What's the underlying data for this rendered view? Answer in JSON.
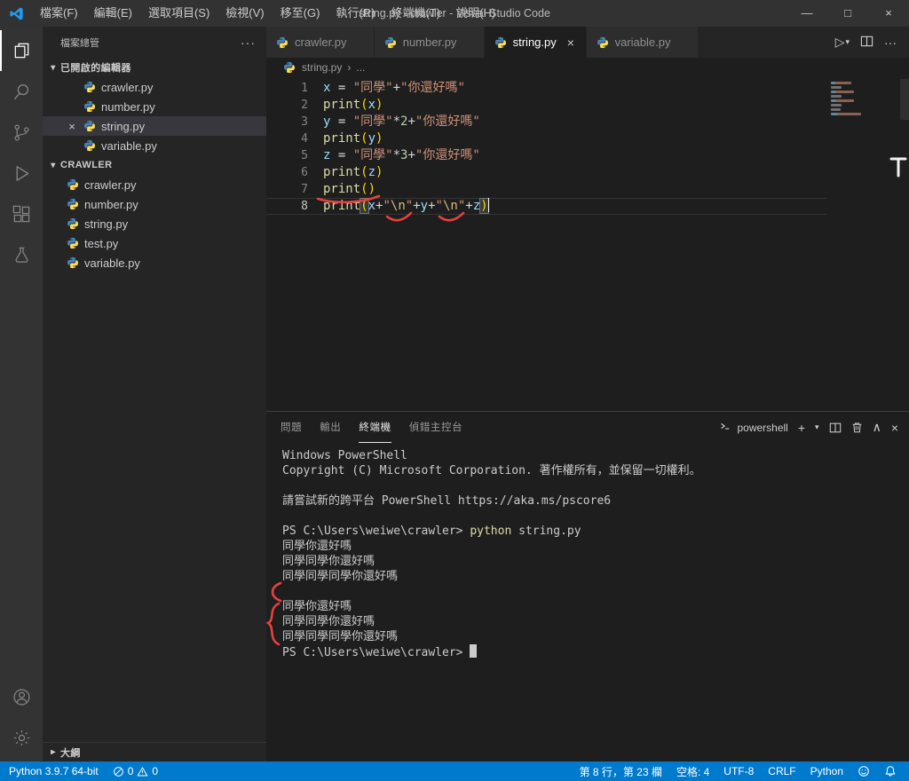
{
  "window": {
    "title": "string.py - crawler - Visual Studio Code",
    "menus": [
      "檔案(F)",
      "編輯(E)",
      "選取項目(S)",
      "檢視(V)",
      "移至(G)",
      "執行(R)",
      "終端機(T)",
      "說明(H)"
    ],
    "controls": {
      "minimize": "—",
      "maximize": "□",
      "close": "×"
    }
  },
  "activity_bar": {
    "top": [
      {
        "name": "explorer",
        "active": true
      },
      {
        "name": "search",
        "active": false
      },
      {
        "name": "source-control",
        "active": false
      },
      {
        "name": "run-debug",
        "active": false
      },
      {
        "name": "extensions",
        "active": false
      },
      {
        "name": "testing",
        "active": false
      }
    ],
    "bottom": [
      {
        "name": "account",
        "active": false
      },
      {
        "name": "settings",
        "active": false
      }
    ]
  },
  "sidebar": {
    "title": "檔案總管",
    "more": "···",
    "open_editors_label": "已開啟的編輯器",
    "open_editors": [
      {
        "label": "crawler.py",
        "active": false
      },
      {
        "label": "number.py",
        "active": false
      },
      {
        "label": "string.py",
        "active": true
      },
      {
        "label": "variable.py",
        "active": false
      }
    ],
    "folder_label": "CRAWLER",
    "files": [
      "crawler.py",
      "number.py",
      "string.py",
      "test.py",
      "variable.py"
    ],
    "outline_label": "大綱"
  },
  "editor": {
    "tabs": [
      {
        "label": "crawler.py",
        "active": false
      },
      {
        "label": "number.py",
        "active": false
      },
      {
        "label": "string.py",
        "active": true
      },
      {
        "label": "variable.py",
        "active": false
      }
    ],
    "breadcrumb": {
      "file": "string.py",
      "symbol": "..."
    },
    "run_icon": "▷",
    "more_icon": "···",
    "lines": [
      {
        "no": "1",
        "tokens": [
          {
            "t": "x",
            "c": "v"
          },
          {
            "t": " = ",
            "c": "o"
          },
          {
            "t": "\"同學\"",
            "c": "s"
          },
          {
            "t": "+",
            "c": "o"
          },
          {
            "t": "\"你還好嗎\"",
            "c": "s"
          }
        ]
      },
      {
        "no": "2",
        "tokens": [
          {
            "t": "print",
            "c": "f"
          },
          {
            "t": "(",
            "c": "p"
          },
          {
            "t": "x",
            "c": "v"
          },
          {
            "t": ")",
            "c": "p"
          }
        ]
      },
      {
        "no": "3",
        "tokens": [
          {
            "t": "y",
            "c": "v"
          },
          {
            "t": " = ",
            "c": "o"
          },
          {
            "t": "\"同學\"",
            "c": "s"
          },
          {
            "t": "*",
            "c": "o"
          },
          {
            "t": "2",
            "c": "n"
          },
          {
            "t": "+",
            "c": "o"
          },
          {
            "t": "\"你還好嗎\"",
            "c": "s"
          }
        ]
      },
      {
        "no": "4",
        "tokens": [
          {
            "t": "print",
            "c": "f"
          },
          {
            "t": "(",
            "c": "p"
          },
          {
            "t": "y",
            "c": "v"
          },
          {
            "t": ")",
            "c": "p"
          }
        ]
      },
      {
        "no": "5",
        "tokens": [
          {
            "t": "z",
            "c": "v"
          },
          {
            "t": " = ",
            "c": "o"
          },
          {
            "t": "\"同學\"",
            "c": "s"
          },
          {
            "t": "*",
            "c": "o"
          },
          {
            "t": "3",
            "c": "n"
          },
          {
            "t": "+",
            "c": "o"
          },
          {
            "t": "\"你還好嗎\"",
            "c": "s"
          }
        ]
      },
      {
        "no": "6",
        "tokens": [
          {
            "t": "print",
            "c": "f"
          },
          {
            "t": "(",
            "c": "p"
          },
          {
            "t": "z",
            "c": "v"
          },
          {
            "t": ")",
            "c": "p"
          }
        ]
      },
      {
        "no": "7",
        "tokens": [
          {
            "t": "print",
            "c": "f"
          },
          {
            "t": "(",
            "c": "p"
          },
          {
            "t": ")",
            "c": "p"
          }
        ]
      },
      {
        "no": "8",
        "current": true,
        "caret": true,
        "tokens": [
          {
            "t": "print",
            "c": "f"
          },
          {
            "t": "(",
            "c": "pm"
          },
          {
            "t": "x",
            "c": "v"
          },
          {
            "t": "+",
            "c": "o"
          },
          {
            "t": "\"",
            "c": "s"
          },
          {
            "t": "\\n",
            "c": "e"
          },
          {
            "t": "\"",
            "c": "s"
          },
          {
            "t": "+",
            "c": "o"
          },
          {
            "t": "y",
            "c": "v"
          },
          {
            "t": "+",
            "c": "o"
          },
          {
            "t": "\"",
            "c": "s"
          },
          {
            "t": "\\n",
            "c": "e"
          },
          {
            "t": "\"",
            "c": "s"
          },
          {
            "t": "+",
            "c": "o"
          },
          {
            "t": "z",
            "c": "v"
          },
          {
            "t": ")",
            "c": "pm"
          }
        ]
      }
    ]
  },
  "panel": {
    "tabs": [
      {
        "label": "問題",
        "active": false
      },
      {
        "label": "輸出",
        "active": false
      },
      {
        "label": "終端機",
        "active": true
      },
      {
        "label": "偵錯主控台",
        "active": false
      }
    ],
    "shell_label": "powershell",
    "terminal": {
      "cursor": true,
      "lines": [
        [
          {
            "t": "Windows PowerShell",
            "c": "plain"
          }
        ],
        [
          {
            "t": "Copyright (C) Microsoft Corporation. 著作權所有，並保留一切權利。",
            "c": "plain"
          }
        ],
        [],
        [
          {
            "t": "請嘗試新的跨平台 PowerShell https://aka.ms/pscore6",
            "c": "plain"
          }
        ],
        [],
        [
          {
            "t": "PS C:\\Users\\weiwe\\crawler> ",
            "c": "plain"
          },
          {
            "t": "python",
            "c": "cmd"
          },
          {
            "t": " string.py",
            "c": "plain"
          }
        ],
        [
          {
            "t": "同學你還好嗎",
            "c": "plain"
          }
        ],
        [
          {
            "t": "同學同學你還好嗎",
            "c": "plain"
          }
        ],
        [
          {
            "t": "同學同學同學你還好嗎",
            "c": "plain"
          }
        ],
        [],
        [
          {
            "t": "同學你還好嗎",
            "c": "plain"
          }
        ],
        [
          {
            "t": "同學同學你還好嗎",
            "c": "plain"
          }
        ],
        [
          {
            "t": "同學同學同學你還好嗎",
            "c": "plain"
          }
        ],
        [
          {
            "t": "PS C:\\Users\\weiwe\\crawler> ",
            "c": "plain"
          }
        ]
      ]
    }
  },
  "status_bar": {
    "python_label": "Python 3.9.7 64-bit",
    "errors": "0",
    "warnings": "0",
    "cursor_position": "第 8 行，第 23 欄",
    "indentation": "空格: 4",
    "encoding": "UTF-8",
    "eol": "CRLF",
    "language": "Python"
  }
}
